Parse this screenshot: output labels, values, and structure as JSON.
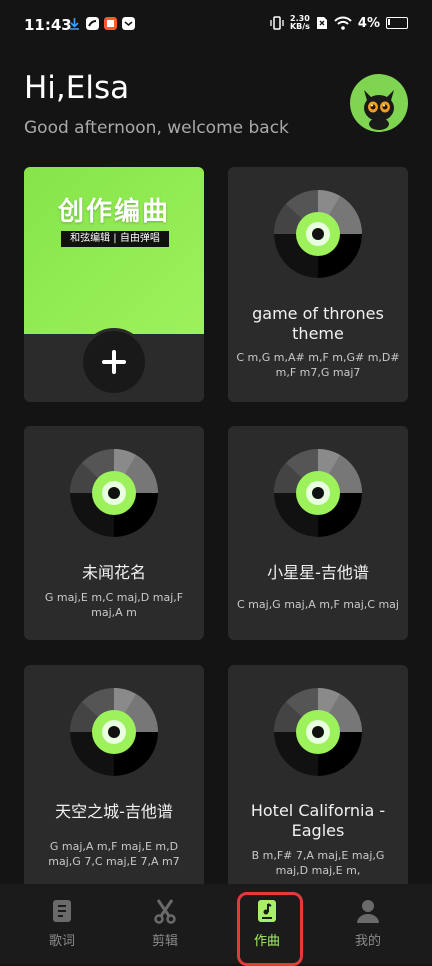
{
  "status_bar": {
    "time": "11:43",
    "net_speed_top": "2.30",
    "net_speed_bottom": "KB/s",
    "battery": "4%"
  },
  "header": {
    "greeting": "Hi,Elsa",
    "subtitle": "Good afternoon, welcome back"
  },
  "create_card": {
    "title": "创作编曲",
    "tag": "和弦编辑 | 自由弹唱"
  },
  "songs": [
    {
      "title": "game of thrones theme",
      "chords": "C m,G m,A# m,F m,G# m,D# m,F m7,G maj7"
    },
    {
      "title": "未闻花名",
      "chords": "G maj,E m,C maj,D maj,F maj,A m"
    },
    {
      "title": "小星星-吉他谱",
      "chords": "C maj,G maj,A m,F maj,C maj"
    },
    {
      "title": "天空之城-吉他谱",
      "chords": "G maj,A m,F maj,E m,D maj,G 7,C maj,E 7,A m7"
    },
    {
      "title": "Hotel California - Eagles",
      "chords": "B m,F# 7,A maj,E maj,G maj,D maj,E m,"
    }
  ],
  "bottom_nav": [
    {
      "label": "歌词",
      "icon": "lyrics-icon"
    },
    {
      "label": "剪辑",
      "icon": "scissors-icon"
    },
    {
      "label": "作曲",
      "icon": "compose-icon"
    },
    {
      "label": "我的",
      "icon": "profile-icon"
    }
  ],
  "colors": {
    "accent_green": "#9df25c",
    "active_label": "#a6f06a",
    "highlight_frame": "#e23b3b"
  }
}
